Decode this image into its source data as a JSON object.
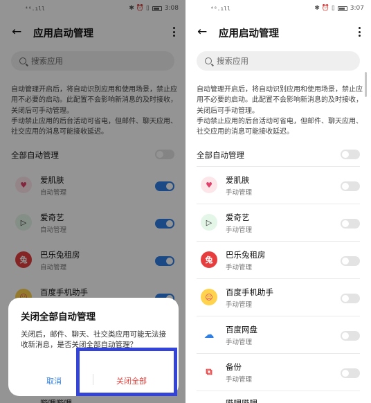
{
  "colors": {
    "accent": "#2f7fe5",
    "danger": "#e8413b",
    "highlight": "#3344d6"
  },
  "left": {
    "status": {
      "signal": "⁴⁶.ıll",
      "time": "3:08"
    },
    "header": {
      "title": "应用启动管理"
    },
    "search": {
      "placeholder": "搜索应用"
    },
    "description": "自动管理开启后，将自动识别应用和使用场景，禁止应用不必要的启动。此配置不会影响新消息的及时接收，关闭后可手动管理。\n手动禁止应用的后台活动可省电，但邮件、聊天应用、社交应用的消息可能接收延迟。",
    "all_label": "全部自动管理",
    "items": [
      {
        "name": "爱肌肤",
        "sub": "自动管理",
        "icon": "heart-icon"
      },
      {
        "name": "爱奇艺",
        "sub": "自动管理",
        "icon": "play-icon"
      },
      {
        "name": "巴乐兔租房",
        "sub": "自动管理",
        "icon": "rabbit-icon"
      },
      {
        "name": "百度手机助手",
        "sub": "",
        "icon": "smile-icon"
      }
    ],
    "dialog": {
      "title": "关闭全部自动管理",
      "message": "关闭后，邮件、聊天、社交类应用可能无法接收新消息，是否关闭全部自动管理？",
      "cancel": "取消",
      "confirm": "关闭全部"
    },
    "partial_text": "哔哩哔哩"
  },
  "right": {
    "status": {
      "signal": "⁴⁶.ıll",
      "time": "3:07"
    },
    "header": {
      "title": "应用启动管理"
    },
    "search": {
      "placeholder": "搜索应用"
    },
    "description": "自动管理开启后，将自动识别应用和使用场景，禁止应用不必要的启动。此配置不会影响新消息的及时接收，关闭后可手动管理。\n手动禁止应用的后台活动可省电，但邮件、聊天应用、社交应用的消息可能接收延迟。",
    "all_label": "全部自动管理",
    "items": [
      {
        "name": "爱肌肤",
        "sub": "手动管理",
        "icon": "heart-icon"
      },
      {
        "name": "爱奇艺",
        "sub": "手动管理",
        "icon": "play-icon"
      },
      {
        "name": "巴乐兔租房",
        "sub": "手动管理",
        "icon": "rabbit-icon"
      },
      {
        "name": "百度手机助手",
        "sub": "手动管理",
        "icon": "smile-icon"
      },
      {
        "name": "百度网盘",
        "sub": "手动管理",
        "icon": "cloud-icon"
      },
      {
        "name": "备份",
        "sub": "手动管理",
        "icon": "backup-icon"
      }
    ],
    "partial_text": "哔哩哔哩"
  }
}
